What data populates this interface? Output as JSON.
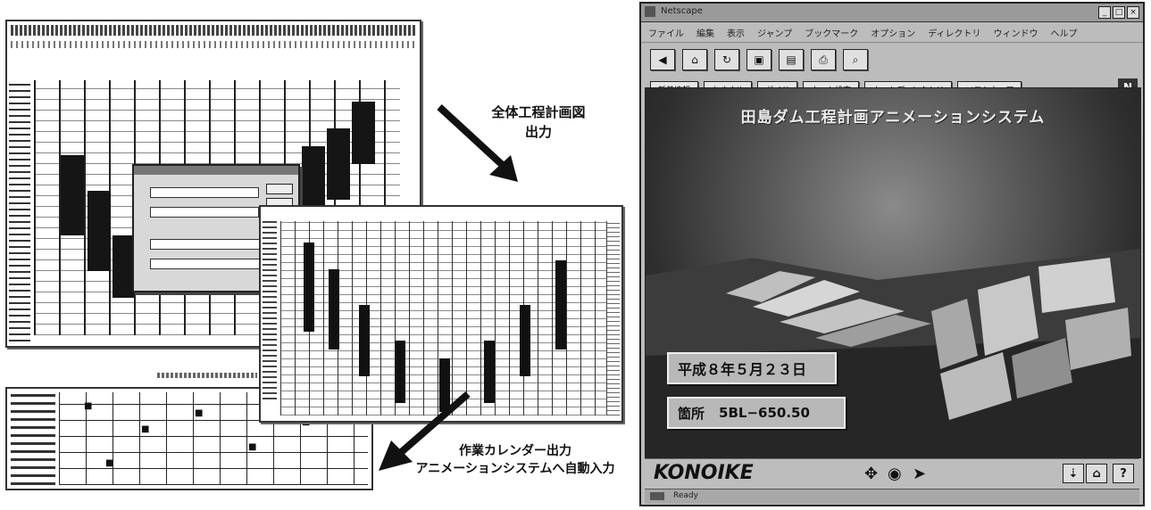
{
  "captions": {
    "overall_chart_line1": "全体工程計画図",
    "overall_chart_line2": "出力",
    "calendar_line1": "作業カレンダー出力",
    "calendar_line2": "アニメーションシステムへ自動入力"
  },
  "window": {
    "title": "Netscape",
    "menu": [
      "ファイル",
      "編集",
      "表示",
      "ジャンプ",
      "ブックマーク",
      "オプション",
      "ディレクトリ",
      "ウィンドウ",
      "ヘルプ"
    ],
    "toolbar_icons": [
      "back-icon",
      "home-icon",
      "reload-icon",
      "images-icon",
      "open-icon",
      "print-icon",
      "find-icon"
    ],
    "nav_buttons": [
      "新着情報",
      "おすすめ",
      "ガイド",
      "ネット検索",
      "ネットディレクトリ",
      "ソフトウェア"
    ],
    "logo_letter": "N",
    "content": {
      "title": "田島ダム工程計画アニメーションシステム",
      "date": "平成８年５月２３日",
      "location_label": "箇所",
      "location_value": "5BL−650.50"
    },
    "brand": "KONOIKE",
    "help_label": "?",
    "status": {
      "text": "Ready",
      "right": ""
    }
  },
  "colors": {
    "window_bg": "#bcbcbc",
    "scene_dark": "#1a1a1a",
    "info_box": "#b8b8b8"
  }
}
